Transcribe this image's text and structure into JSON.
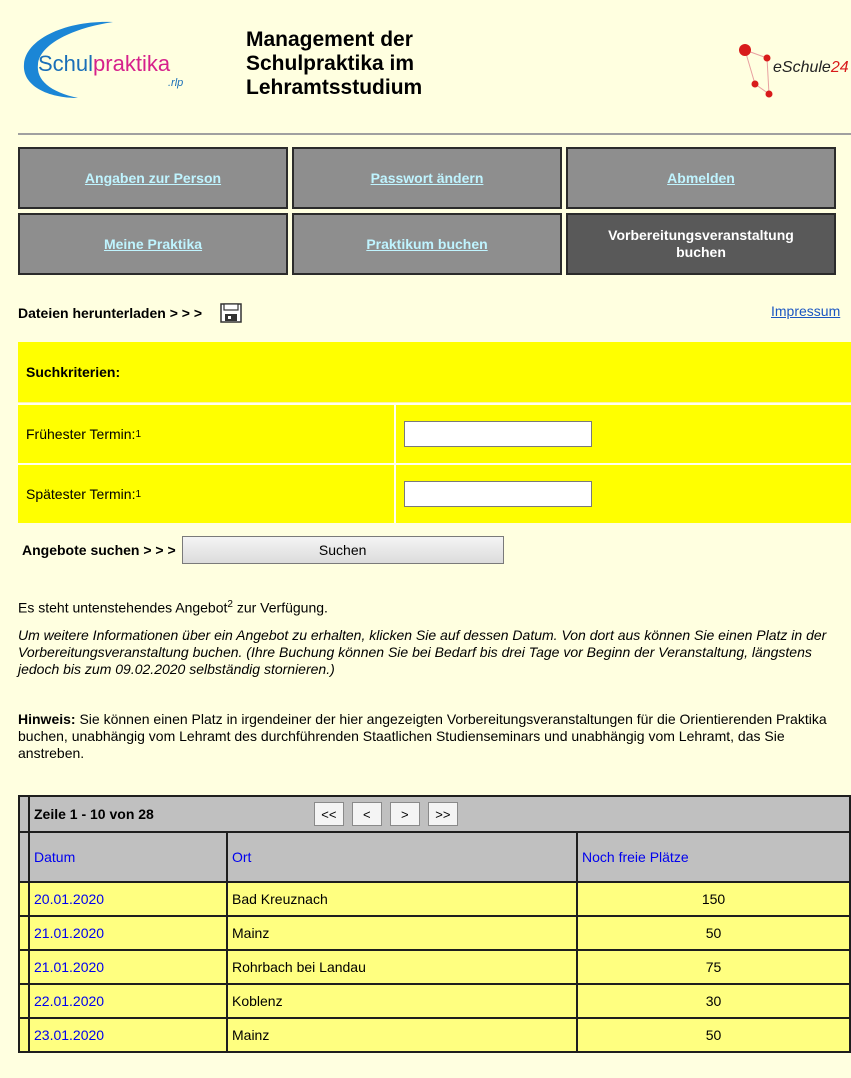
{
  "header": {
    "logo_left_text_main": "Schulpraktika",
    "logo_left_text_sub": ".rlp",
    "title": "Management der Schulpraktika im Lehramtsstudium",
    "logo_right_text": "eSchule24"
  },
  "nav": {
    "row1": [
      "Angaben zur Person",
      "Passwort ändern",
      "Abmelden"
    ],
    "row2": [
      "Meine Praktika",
      "Praktikum buchen",
      "Vorbereitungsveranstaltung buchen"
    ]
  },
  "download_label": "Dateien herunterladen > > >",
  "impressum_label": "Impressum",
  "search": {
    "heading": "Suchkriterien:",
    "earliest_label": "Frühester Termin:",
    "latest_label": "Spätester Termin:",
    "footnote": "1",
    "earliest_value": "",
    "latest_value": "",
    "submit_prefix": "Angebote suchen > > >",
    "submit_label": "Suchen"
  },
  "texts": {
    "p1_before": "Es steht untenstehendes Angebot",
    "p1_sup": "2",
    "p1_after": " zur Verfügung.",
    "p2": "Um weitere Informationen über ein Angebot zu erhalten, klicken Sie auf dessen Datum. Von dort aus können Sie einen Platz in der Vorbereitungsveranstaltung buchen. (Ihre Buchung können Sie bei Bedarf bis drei Tage vor Beginn der Veranstaltung, längstens jedoch bis zum 09.02.2020 selbständig stornieren.)",
    "p3_bold": "Hinweis:",
    "p3_rest": " Sie können einen Platz in irgendeiner der hier angezeigten Vorbereitungsveranstaltungen für die Orientierenden Praktika buchen, unabhängig vom Lehramt des durchführenden Staatlichen Studienseminars und unabhängig vom Lehramt, das Sie anstreben."
  },
  "table": {
    "range_label": "Zeile 1 - 10 von 28",
    "pager": [
      "<<",
      "<",
      ">",
      ">>"
    ],
    "columns": [
      "Datum",
      "Ort",
      "Noch freie Plätze"
    ],
    "rows": [
      [
        "20.01.2020",
        "Bad Kreuznach",
        "150"
      ],
      [
        "21.01.2020",
        "Mainz",
        "50"
      ],
      [
        "21.01.2020",
        "Rohrbach bei Landau",
        "75"
      ],
      [
        "22.01.2020",
        "Koblenz",
        "30"
      ],
      [
        "23.01.2020",
        "Mainz",
        "50"
      ]
    ]
  }
}
